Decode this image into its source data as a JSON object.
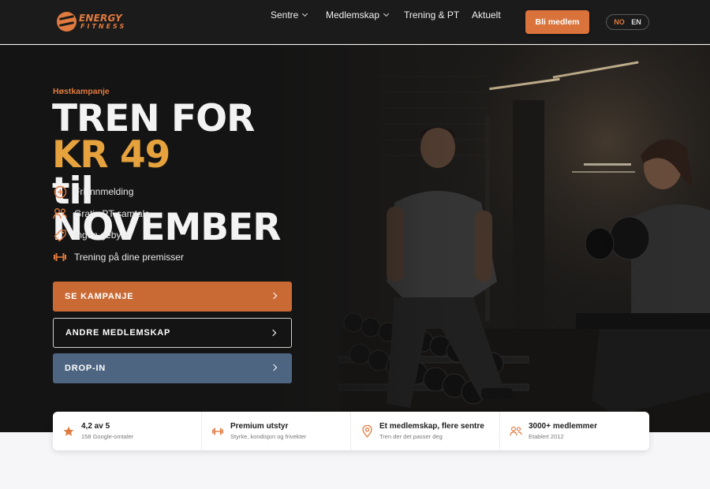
{
  "brand": {
    "logo_line1": "ENERGY",
    "logo_line2": "FITNESS",
    "color": "#e07a3f"
  },
  "nav": {
    "items": [
      {
        "label": "Sentre",
        "has_dropdown": true
      },
      {
        "label": "Medlemskap",
        "has_dropdown": true
      },
      {
        "label": "Trening & PT",
        "has_dropdown": false
      },
      {
        "label": "Aktuelt",
        "has_dropdown": false
      }
    ],
    "cta_label": "Bli medlem",
    "lang": {
      "no": "NO",
      "en": "EN",
      "active": "NO"
    }
  },
  "hero": {
    "eyebrow": "Høstkampanje",
    "headline_part1": "TREN FOR ",
    "headline_accent": "KR 49",
    "headline_line2": "til NOVEMBER",
    "accent_color": "#e6a23c",
    "features": [
      {
        "icon": "plus-circle-icon",
        "label": "Fri innmelding"
      },
      {
        "icon": "people-chat-icon",
        "label": "Gratis PT-samtale"
      },
      {
        "icon": "tag-icon",
        "label": "Ingen gebyrer"
      },
      {
        "icon": "dumbbell-icon",
        "label": "Trening på dine premisser"
      }
    ],
    "buttons": [
      {
        "label": "SE KAMPANJE",
        "style": "primary",
        "color": "#c96a35"
      },
      {
        "label": "ANDRE MEDLEMSKAP",
        "style": "outline"
      },
      {
        "label": "DROP-IN",
        "style": "secondary",
        "color": "#4e6582"
      }
    ]
  },
  "stats": [
    {
      "icon": "star-icon",
      "title": "4,2 av 5",
      "sub": "158 Google-omtaler"
    },
    {
      "icon": "dumbbell-icon",
      "title": "Premium utstyr",
      "sub": "Styrke, kondisjon og frivekter"
    },
    {
      "icon": "location-pin-icon",
      "title": "Et medlemskap, flere sentre",
      "sub": "Tren der det passer deg"
    },
    {
      "icon": "people-icon",
      "title": "3000+ medlemmer",
      "sub": "Etablert 2012"
    }
  ]
}
